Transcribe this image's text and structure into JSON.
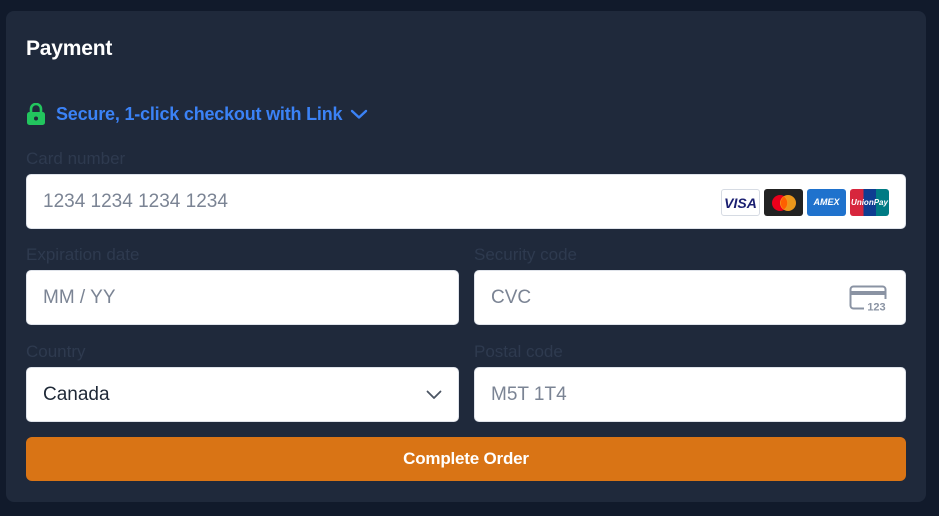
{
  "header": {
    "title": "Payment"
  },
  "link": {
    "label": "Secure, 1-click checkout with Link",
    "lock_icon": "lock-icon",
    "chevron_icon": "chevron-down-icon",
    "accent": "#3b82f6",
    "lock_color": "#22c55e"
  },
  "card_number": {
    "label": "Card number",
    "placeholder": "1234 1234 1234 1234",
    "value": "",
    "brands": [
      "VISA",
      "Mastercard",
      "AMEX",
      "UnionPay"
    ]
  },
  "expiration": {
    "label": "Expiration date",
    "placeholder": "MM / YY",
    "value": ""
  },
  "security_code": {
    "label": "Security code",
    "placeholder": "CVC",
    "value": "",
    "icon": "cvc-card-icon",
    "icon_text": "123"
  },
  "country": {
    "label": "Country",
    "value": "Canada"
  },
  "postal_code": {
    "label": "Postal code",
    "placeholder": "M5T 1T4",
    "value": ""
  },
  "submit": {
    "label": "Complete Order",
    "color": "#d97415"
  }
}
